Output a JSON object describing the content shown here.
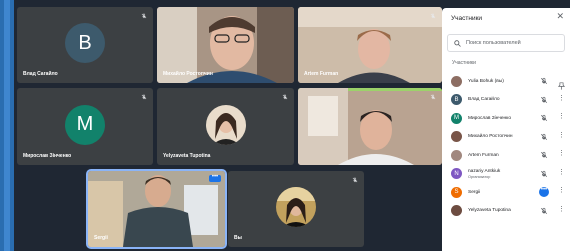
{
  "tiles": [
    {
      "name": "Влад Сагайло",
      "initial": "B",
      "avatar_color": "#3d5a6c",
      "muted": true
    },
    {
      "name": "Михайло Ростопчин",
      "muted": false
    },
    {
      "name": "Artem Furman",
      "muted": true
    },
    {
      "name": "Мирослав Зінченко",
      "initial": "M",
      "avatar_color": "#12826b",
      "muted": true
    },
    {
      "name": "Yelyzaveta Tupotina",
      "muted": true
    },
    {
      "name": "",
      "muted": true
    },
    {
      "name": "Sergii",
      "more": "•••",
      "active": true
    },
    {
      "name": "Вы",
      "muted": true
    }
  ],
  "panel": {
    "title": "Участники",
    "close": "✕",
    "search_placeholder": "Поиск пользователей",
    "section": "Участники",
    "participants": [
      {
        "name": "Yulia Bohuk (вы)",
        "sub": "",
        "initial": "",
        "color": "#8d6e63",
        "mic": "muted",
        "action": "pin"
      },
      {
        "name": "Влад Сагайло",
        "sub": "",
        "initial": "B",
        "color": "#3d5a6c",
        "mic": "muted",
        "action": "more"
      },
      {
        "name": "Мирослав Зінченко",
        "sub": "",
        "initial": "M",
        "color": "#12826b",
        "mic": "muted",
        "action": "more"
      },
      {
        "name": "Михайло Ростопчин",
        "sub": "",
        "initial": "",
        "color": "#795548",
        "mic": "muted",
        "action": "more"
      },
      {
        "name": "Artem Furman",
        "sub": "",
        "initial": "",
        "color": "#a1887f",
        "mic": "muted",
        "action": "more"
      },
      {
        "name": "nazariy Antkiuk",
        "sub": "Организатор",
        "initial": "N",
        "color": "#7e57c2",
        "mic": "muted",
        "action": "more"
      },
      {
        "name": "Sergii",
        "sub": "",
        "initial": "S",
        "color": "#ef6c00",
        "mic": "speaking",
        "action": "more"
      },
      {
        "name": "Yelyzaveta Tupotina",
        "sub": "",
        "initial": "",
        "color": "#6d4c41",
        "mic": "muted",
        "action": "more"
      }
    ]
  },
  "icons": {
    "mic_off": "mic-off-icon",
    "search": "search-icon",
    "more": "more-vert-icon",
    "pin": "pin-icon"
  }
}
